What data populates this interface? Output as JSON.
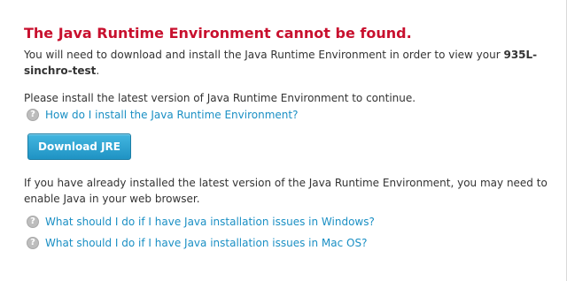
{
  "title": "The Java Runtime Environment cannot be found.",
  "intro": {
    "text_before": "You will need to download and install the Java Runtime Environment in order to view your ",
    "app_name": "935L-sinchro-test",
    "text_after": "."
  },
  "install_prompt": "Please install the latest version of Java Runtime Environment to continue.",
  "help_links": [
    {
      "label": "How do I install the Java Runtime Environment?",
      "icon": "question-circle-icon"
    },
    {
      "label": "What should I do if I have Java installation issues in Windows?",
      "icon": "question-circle-icon"
    },
    {
      "label": "What should I do if I have Java installation issues in Mac OS?",
      "icon": "question-circle-icon"
    }
  ],
  "download_button": {
    "label": "Download JRE"
  },
  "already_installed": "If you have already installed the latest version of the Java Runtime Environment, you may need to enable Java in your web browser.",
  "colors": {
    "title": "#c8102e",
    "link": "#1a8fc4",
    "button": "#1f93c4",
    "icon": "#bdbdbd"
  }
}
